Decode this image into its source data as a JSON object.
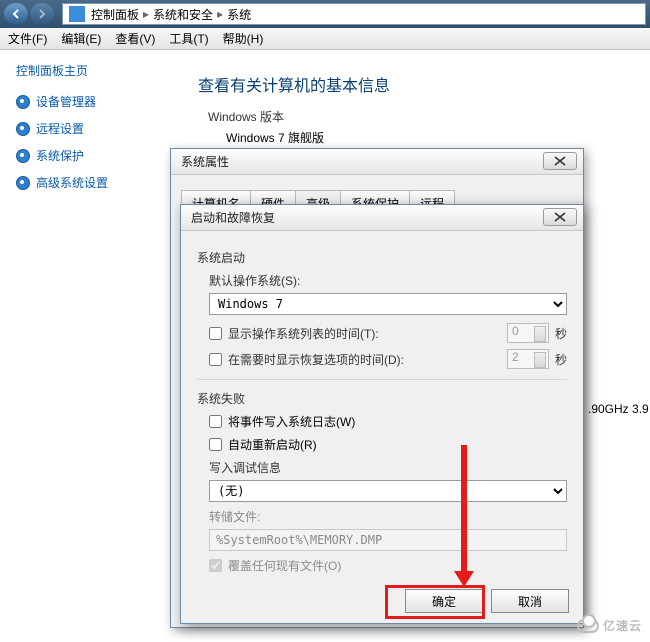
{
  "breadcrumb": {
    "root": "控制面板",
    "mid": "系统和安全",
    "leaf": "系统"
  },
  "menubar": {
    "file": "文件(F)",
    "edit": "编辑(E)",
    "view": "查看(V)",
    "tools": "工具(T)",
    "help": "帮助(H)"
  },
  "sidebar": {
    "home": "控制面板主页",
    "items": [
      "设备管理器",
      "远程设置",
      "系统保护",
      "高级系统设置"
    ]
  },
  "main": {
    "heading": "查看有关计算机的基本信息",
    "win_section": "Windows 版本",
    "win_edition": "Windows 7 旗舰版",
    "cpu_tail": ".90GHz   3.9"
  },
  "dlg1": {
    "title": "系统属性",
    "tabs": [
      "计算机名",
      "硬件",
      "高级",
      "系统保护",
      "远程"
    ],
    "active_tab": 2
  },
  "dlg2": {
    "title": "启动和故障恢复",
    "grp_start": "系统启动",
    "default_os_label": "默认操作系统(S):",
    "default_os_value": "Windows 7",
    "show_os_list": "显示操作系统列表的时间(T):",
    "show_recovery": "在需要时显示恢复选项的时间(D):",
    "sec_unit": "秒",
    "spin1": "0",
    "spin2": "2",
    "grp_fail": "系统失败",
    "write_event": "将事件写入系统日志(W)",
    "auto_restart": "自动重新启动(R)",
    "dump_label": "写入调试信息",
    "dump_select": "(无)",
    "dump_file_label": "转储文件:",
    "dump_file_value": "%SystemRoot%\\MEMORY.DMP",
    "overwrite": "覆盖任何现有文件(O)",
    "ok": "确定",
    "cancel": "取消"
  },
  "watermark": "亿速云"
}
